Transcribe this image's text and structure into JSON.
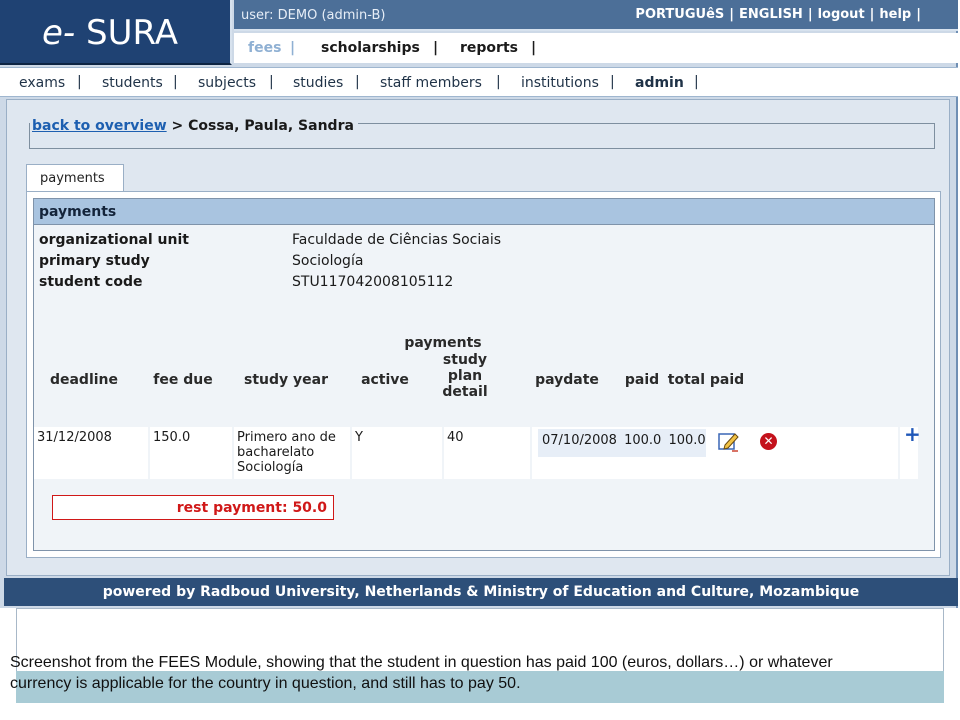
{
  "header": {
    "logo_e": "e-",
    "logo_name": " SURA",
    "user": "user: DEMO (admin-B)",
    "lang_pt": "PORTUGUêS",
    "lang_en": "ENGLISH",
    "logout": "logout",
    "help": "help",
    "separator": "|",
    "modules": [
      "fees",
      "scholarships",
      "reports"
    ]
  },
  "nav": {
    "items": [
      "exams",
      "students",
      "subjects",
      "studies",
      "staff members",
      "institutions",
      "admin"
    ],
    "separator": "|"
  },
  "breadcrumb": {
    "back": "back to overview",
    "arrow": ">",
    "student": "Cossa, Paula, Sandra"
  },
  "tab": "payments",
  "panel": {
    "title": "payments",
    "labels": [
      "organizational unit",
      "primary study",
      "student code"
    ],
    "values": [
      "Faculdade de Ciências Sociais",
      "Sociología",
      "STU117042008105112"
    ]
  },
  "table": {
    "group_header": "payments",
    "columns": [
      "deadline",
      "fee due",
      "study year",
      "active",
      "study plan detail",
      "paydate",
      "paid",
      "total paid"
    ],
    "row": {
      "deadline": "31/12/2008",
      "fee_due": "150.0",
      "study_year": "Primero ano de bacharelato Sociología",
      "active": "Y",
      "study_plan_detail": "40",
      "paydate": "07/10/2008",
      "paid": "100.0",
      "total_paid": "100.0"
    }
  },
  "icons": {
    "edit": "edit-icon",
    "delete": "delete-icon",
    "add": "add-icon"
  },
  "rest_payment": "rest payment: 50.0",
  "footer": "powered by Radboud University, Netherlands & Ministry of Education and Culture, Mozambique",
  "caption": {
    "line1": "Screenshot from the FEES Module, showing that the student in question has paid 100 (euros, dollars…) or whatever",
    "line2": "currency is applicable for the country in question, and still has to pay 50."
  },
  "colors": {
    "header_dark": "#1f4273",
    "header_mid": "#4c6f98",
    "panel_header": "#a9c4e0",
    "alert_red": "#d01818",
    "footer": "#2d4f79"
  }
}
